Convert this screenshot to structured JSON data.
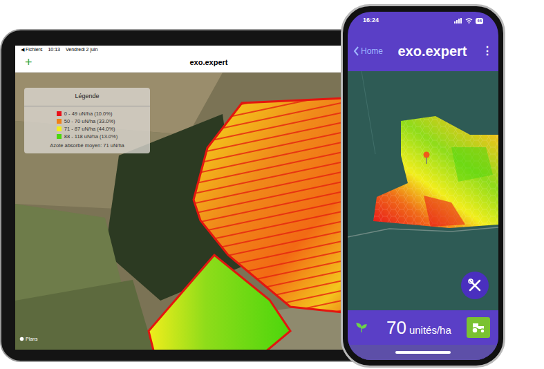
{
  "ipad": {
    "status_bar": {
      "back": "◀ Fichiers",
      "time": "10:13",
      "date": "Vendredi 2 juin"
    },
    "nav": {
      "add": "+",
      "title": "exo.expert"
    },
    "legend": {
      "title": "Légende",
      "items": [
        {
          "label": "0 - 49 uN/ha (10.0%)",
          "color": "#e8101a"
        },
        {
          "label": "50 - 70 uN/ha (33.0%)",
          "color": "#f07f18"
        },
        {
          "label": "71 - 87 uN/ha (44.0%)",
          "color": "#f2ee1c"
        },
        {
          "label": "88 - 118 uN/ha (13.0%)",
          "color": "#4cd60c"
        }
      ],
      "average": "Azote absorbé moyen: 71 uN/ha"
    },
    "map_attribution": "Plans"
  },
  "phone": {
    "status_bar": {
      "time": "16:24",
      "battery": "46"
    },
    "nav": {
      "back": "Home",
      "title": "exo.expert",
      "menu": "⋮"
    },
    "dose": {
      "value": "70",
      "unit": "unités/ha"
    }
  }
}
